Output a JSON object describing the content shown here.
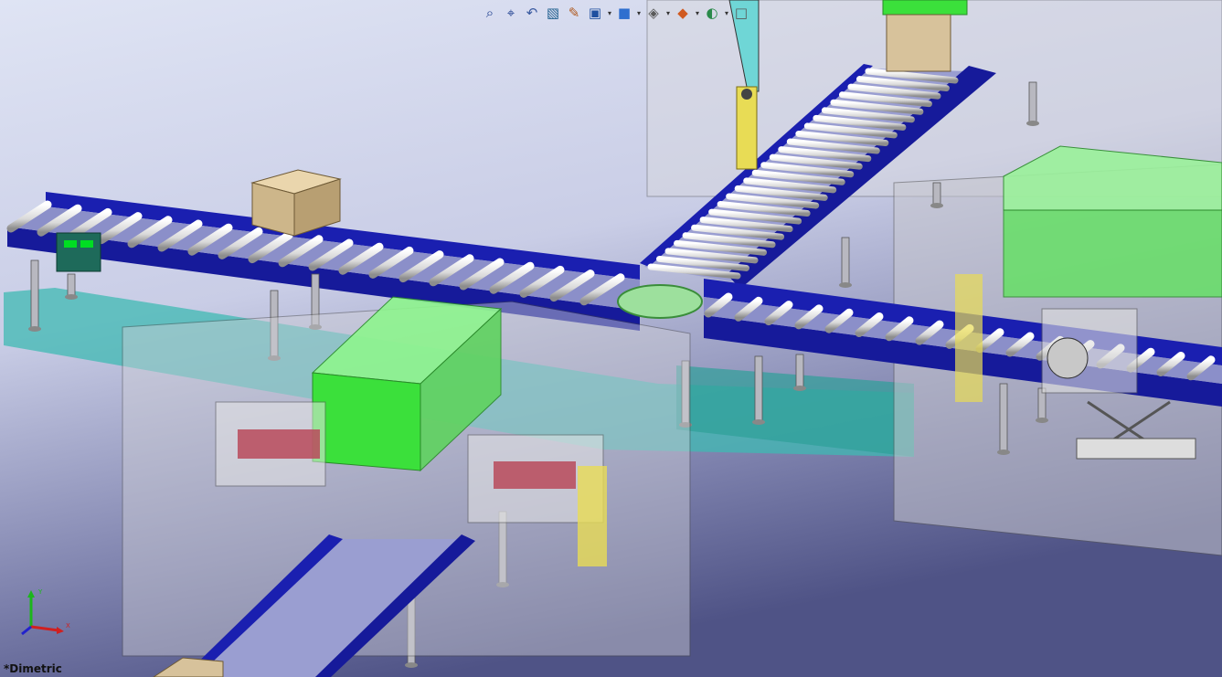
{
  "view": {
    "orientation_label": "*Dimetric"
  },
  "triad": {
    "x_label": "X",
    "y_label": "Y"
  },
  "heads_up_toolbar": {
    "buttons": [
      {
        "name": "zoom-to-fit-icon",
        "has_dropdown": false
      },
      {
        "name": "zoom-to-area-icon",
        "has_dropdown": false
      },
      {
        "name": "previous-view-icon",
        "has_dropdown": false
      },
      {
        "name": "section-view-icon",
        "has_dropdown": false
      },
      {
        "name": "dynamic-annotation-icon",
        "has_dropdown": false
      },
      {
        "name": "view-orientation-icon",
        "has_dropdown": true
      },
      {
        "name": "display-style-icon",
        "has_dropdown": true
      },
      {
        "name": "hide-show-items-icon",
        "has_dropdown": true
      },
      {
        "name": "edit-appearance-icon",
        "has_dropdown": true
      },
      {
        "name": "apply-scene-icon",
        "has_dropdown": true
      },
      {
        "name": "view-settings-icon",
        "has_dropdown": false
      }
    ]
  },
  "colors": {
    "bg_top": "#d6dcef",
    "bg_bottom": "#55598a",
    "conveyor_frame": "#1a1fb0",
    "roller": "#e6e6e6",
    "green_block": "#5de05d",
    "teal_base": "#2aa7a0",
    "cardboard": "#d8c49e",
    "yellow": "#e8dc55"
  }
}
